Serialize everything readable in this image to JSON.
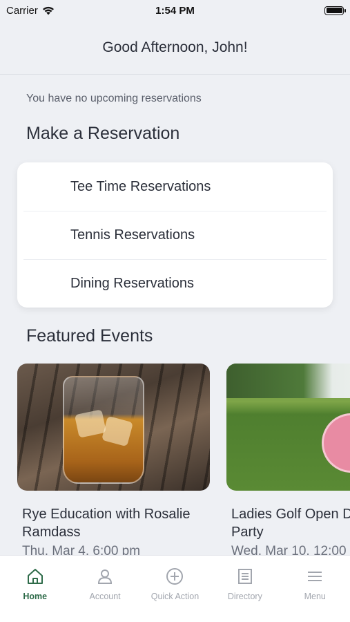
{
  "status": {
    "carrier": "Carrier",
    "time": "1:54 PM"
  },
  "header": {
    "greeting": "Good Afternoon, John!"
  },
  "reservations": {
    "empty_message": "You have no upcoming reservations",
    "section_title": "Make a Reservation",
    "items": [
      {
        "label": "Tee Time Reservations"
      },
      {
        "label": "Tennis Reservations"
      },
      {
        "label": "Dining Reservations"
      }
    ]
  },
  "events": {
    "section_title": "Featured Events",
    "items": [
      {
        "title": "Rye Education with Rosalie Ramdass",
        "date": "Thu, Mar 4, 6:00 pm",
        "image_icon": "whiskey-glass"
      },
      {
        "title": "Ladies Golf Open Dinner Party",
        "date": "Wed, Mar 10, 12:00",
        "image_icon": "golf-course-seal"
      }
    ]
  },
  "tabbar": {
    "items": [
      {
        "label": "Home",
        "icon": "home-icon",
        "active": true
      },
      {
        "label": "Account",
        "icon": "account-icon",
        "active": false
      },
      {
        "label": "Quick Action",
        "icon": "plus-circle-icon",
        "active": false
      },
      {
        "label": "Directory",
        "icon": "directory-icon",
        "active": false
      },
      {
        "label": "Menu",
        "icon": "menu-icon",
        "active": false
      }
    ],
    "active_color": "#2e6b49",
    "inactive_color": "#a2a6ae"
  }
}
